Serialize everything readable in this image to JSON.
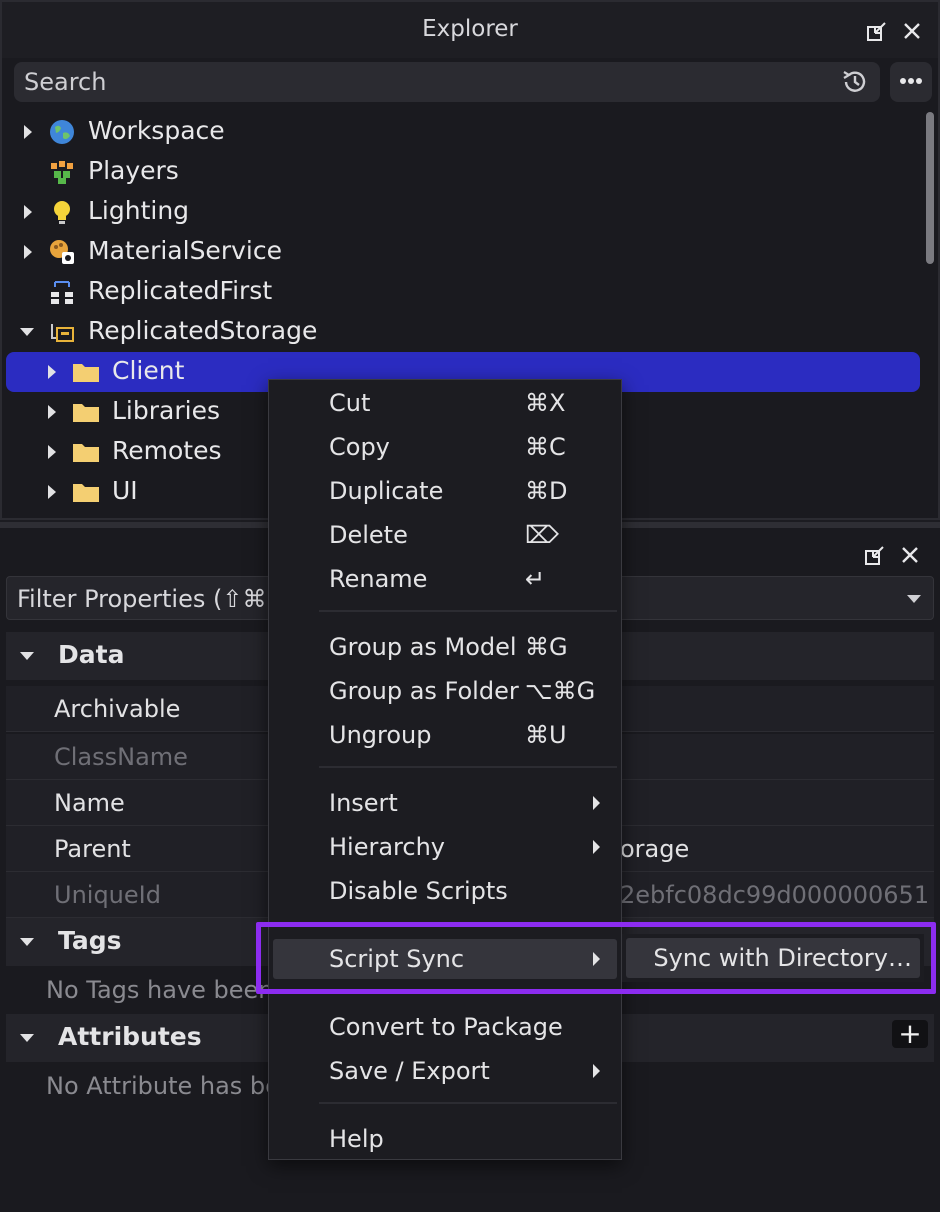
{
  "explorer": {
    "title": "Explorer",
    "search_placeholder": "Search",
    "items": [
      {
        "label": "Workspace",
        "icon": "globe-icon",
        "expander": "collapsed"
      },
      {
        "label": "Players",
        "icon": "players-icon",
        "expander": "none"
      },
      {
        "label": "Lighting",
        "icon": "lightbulb-icon",
        "expander": "collapsed"
      },
      {
        "label": "MaterialService",
        "icon": "material-service-icon",
        "expander": "collapsed"
      },
      {
        "label": "ReplicatedFirst",
        "icon": "replicated-first-icon",
        "expander": "none"
      },
      {
        "label": "ReplicatedStorage",
        "icon": "replicated-storage-icon",
        "expander": "expanded"
      },
      {
        "label": "Client",
        "icon": "folder-icon",
        "expander": "collapsed",
        "selected": true
      },
      {
        "label": "Libraries",
        "icon": "folder-icon",
        "expander": "collapsed"
      },
      {
        "label": "Remotes",
        "icon": "folder-icon",
        "expander": "collapsed"
      },
      {
        "label": "UI",
        "icon": "folder-icon",
        "expander": "collapsed"
      }
    ]
  },
  "properties": {
    "filter_placeholder": "Filter Properties (⇧⌘P",
    "sections": {
      "data": "Data",
      "tags": "Tags",
      "attributes": "Attributes"
    },
    "rows": [
      {
        "name": "Archivable",
        "value": "",
        "dim": false
      },
      {
        "name": "ClassName",
        "value": "",
        "dim": true
      },
      {
        "name": "Name",
        "value": "",
        "dim": false
      },
      {
        "name": "Parent",
        "value": "orage",
        "dim": false
      },
      {
        "name": "UniqueId",
        "value": "2ebfc08dc99d000000651",
        "dim": true
      }
    ],
    "tags_empty": "No Tags have been a",
    "attributes_empty": "No Attribute has bee",
    "add_attribute_label": "+"
  },
  "context_menu": {
    "items": [
      {
        "label": "Cut",
        "shortcut": "⌘X"
      },
      {
        "label": "Copy",
        "shortcut": "⌘C"
      },
      {
        "label": "Duplicate",
        "shortcut": "⌘D"
      },
      {
        "label": "Delete",
        "shortcut": "⌦"
      },
      {
        "label": "Rename",
        "shortcut": "↵"
      },
      {
        "label": "Group as Model",
        "shortcut": "⌘G"
      },
      {
        "label": "Group as Folder",
        "shortcut": "⌥⌘G"
      },
      {
        "label": "Ungroup",
        "shortcut": "⌘U"
      },
      {
        "label": "Insert",
        "submenu": true
      },
      {
        "label": "Hierarchy",
        "submenu": true
      },
      {
        "label": "Disable Scripts"
      },
      {
        "label": "Script Sync",
        "submenu": true,
        "active": true
      },
      {
        "label": "Convert to Package"
      },
      {
        "label": "Save / Export",
        "submenu": true
      },
      {
        "label": "Help"
      }
    ],
    "submenu": {
      "label": "Sync with Directory…"
    }
  },
  "colors": {
    "selection": "#2b2cc1",
    "highlight_outline": "#8c2cf0",
    "background": "#1a1a1f"
  }
}
